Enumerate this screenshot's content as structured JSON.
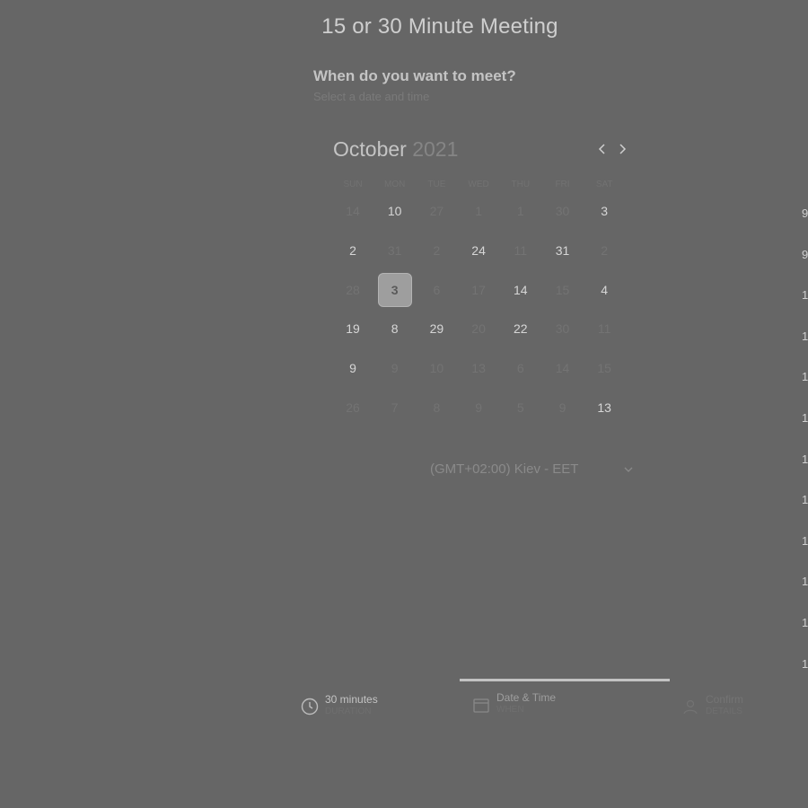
{
  "header": {
    "title": "15 or 30 Minute Meeting",
    "question": "When do you want to meet?",
    "hint": "Select a date and time"
  },
  "calendar": {
    "month": "October",
    "year": "2021",
    "weekdays": [
      "SUN",
      "MON",
      "TUE",
      "WED",
      "THU",
      "FRI",
      "SAT"
    ],
    "selected_day": "3",
    "rows": [
      [
        {
          "d": "14",
          "s": "off"
        },
        {
          "d": "10",
          "s": "on"
        },
        {
          "d": "27",
          "s": "off"
        },
        {
          "d": "1",
          "s": "off"
        },
        {
          "d": "1",
          "s": "off"
        },
        {
          "d": "30",
          "s": "off"
        },
        {
          "d": "3",
          "s": "on"
        }
      ],
      [
        {
          "d": "2",
          "s": "on"
        },
        {
          "d": "31",
          "s": "off"
        },
        {
          "d": "2",
          "s": "off"
        },
        {
          "d": "24",
          "s": "on"
        },
        {
          "d": "11",
          "s": "off"
        },
        {
          "d": "31",
          "s": "on"
        },
        {
          "d": "2",
          "s": "off"
        }
      ],
      [
        {
          "d": "28",
          "s": "off"
        },
        {
          "d": "3",
          "s": "sel"
        },
        {
          "d": "6",
          "s": "off"
        },
        {
          "d": "17",
          "s": "off"
        },
        {
          "d": "14",
          "s": "on"
        },
        {
          "d": "15",
          "s": "off"
        },
        {
          "d": "4",
          "s": "on"
        }
      ],
      [
        {
          "d": "19",
          "s": "on"
        },
        {
          "d": "8",
          "s": "on"
        },
        {
          "d": "29",
          "s": "on"
        },
        {
          "d": "20",
          "s": "off"
        },
        {
          "d": "22",
          "s": "on"
        },
        {
          "d": "30",
          "s": "off"
        },
        {
          "d": "11",
          "s": "off"
        }
      ],
      [
        {
          "d": "9",
          "s": "on"
        },
        {
          "d": "9",
          "s": "off"
        },
        {
          "d": "10",
          "s": "off"
        },
        {
          "d": "13",
          "s": "off"
        },
        {
          "d": "6",
          "s": "off"
        },
        {
          "d": "14",
          "s": "off"
        },
        {
          "d": "15",
          "s": "off"
        }
      ],
      [
        {
          "d": "26",
          "s": "off"
        },
        {
          "d": "7",
          "s": "off"
        },
        {
          "d": "8",
          "s": "off"
        },
        {
          "d": "9",
          "s": "off"
        },
        {
          "d": "5",
          "s": "off"
        },
        {
          "d": "9",
          "s": "off"
        },
        {
          "d": "13",
          "s": "on"
        }
      ]
    ]
  },
  "timezone": {
    "label": "(GMT+02:00) Kiev - EET"
  },
  "side_slots": [
    "9",
    "9",
    "1",
    "1",
    "1",
    "1",
    "1",
    "1",
    "1",
    "1",
    "1",
    "1"
  ],
  "steps": [
    {
      "icon": "clock-icon",
      "title": "30 minutes",
      "subtitle": "DURATION",
      "state": "done"
    },
    {
      "icon": "calendar-icon",
      "title": "Date & Time",
      "subtitle": "WHEN",
      "state": "active"
    },
    {
      "icon": "user-icon",
      "title": "Confirm",
      "subtitle": "DETAILS",
      "state": "pending"
    }
  ],
  "colors": {
    "background": "#666666",
    "selected_day_bg": "#9e9e9e",
    "progress": "#c2c2c2"
  }
}
